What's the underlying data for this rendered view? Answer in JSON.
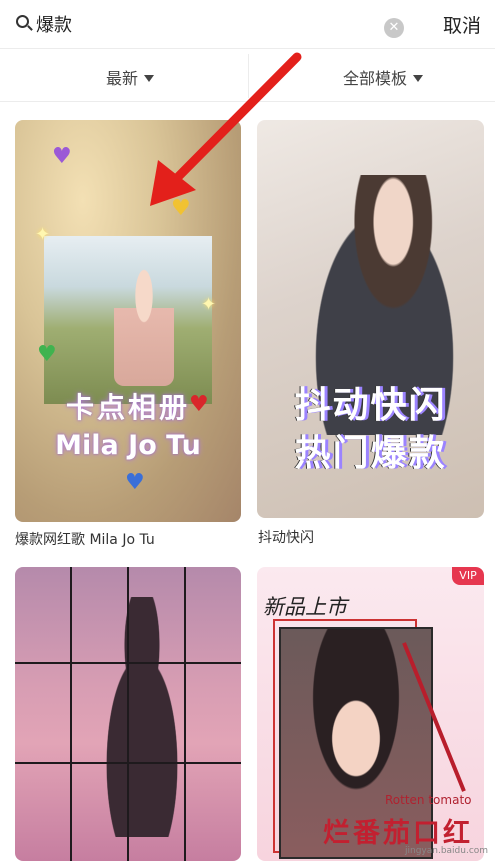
{
  "search": {
    "value": "爆款",
    "cancel_label": "取消",
    "clear_icon": "close-circle-icon"
  },
  "filters": {
    "sort_label": "最新",
    "category_label": "全部模板"
  },
  "templates": [
    {
      "caption": "爆款网红歌 Mila Jo Tu",
      "overlay_line1": "卡点相册",
      "overlay_line2": "Mila Jo Tu"
    },
    {
      "caption": "抖动快闪",
      "overlay_line1": "抖动快闪",
      "overlay_line2": "热门爆款"
    },
    {
      "caption": ""
    },
    {
      "caption": "",
      "badge": "VIP",
      "handwriting": "新品上市",
      "product_text": "Rotten tomato",
      "big_text": "烂番茄口红"
    }
  ],
  "watermark": "jingyan.baidu.com",
  "colors": {
    "accent_red": "#e6374f",
    "arrow_red": "#e3201b"
  }
}
